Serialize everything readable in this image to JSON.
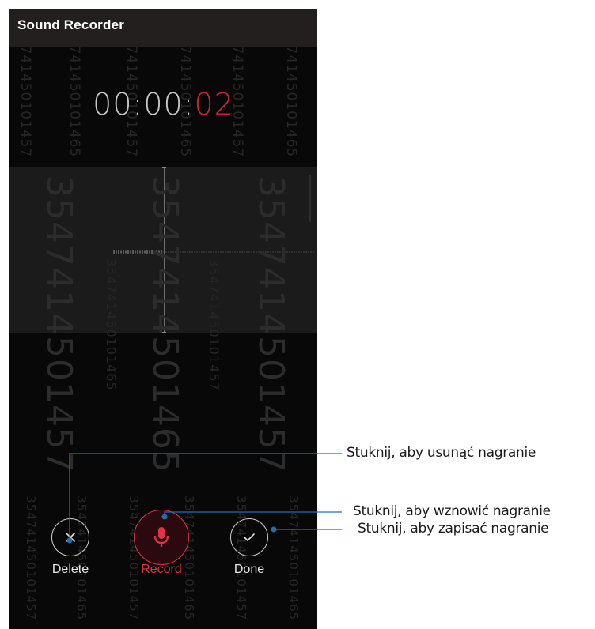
{
  "app": {
    "title": "Sound Recorder"
  },
  "timer": {
    "prefix": "00:00:",
    "seconds": "02"
  },
  "watermark": {
    "big_a": "3547414501457",
    "big_b": "3547414501465",
    "small_a": "354741450101457",
    "small_b": "354741450101465"
  },
  "controls": {
    "delete": {
      "label": "Delete",
      "icon": "close-icon"
    },
    "record": {
      "label": "Record",
      "icon": "microphone-icon"
    },
    "done": {
      "label": "Done",
      "icon": "check-icon"
    }
  },
  "callouts": {
    "delete": "Stuknij, aby usunąć nagranie",
    "record": "Stuknij, aby wznowić nagranie",
    "done": "Stuknij, aby zapisać nagranie"
  },
  "colors": {
    "accent": "#e23248",
    "timer_seconds": "#c4283d",
    "callout_line": "#1d6fb8",
    "background": "#080808"
  }
}
